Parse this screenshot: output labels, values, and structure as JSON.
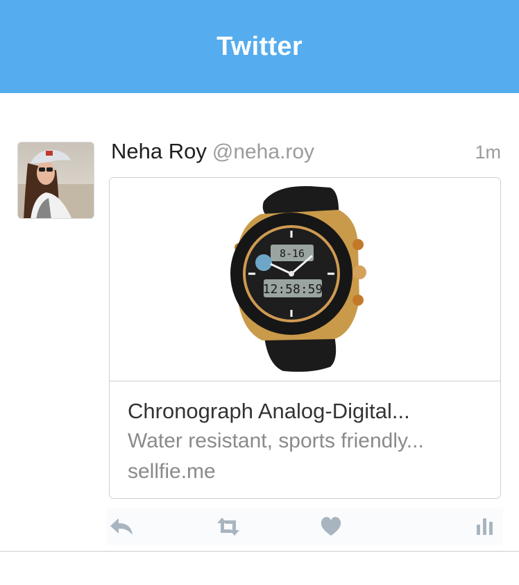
{
  "header": {
    "title": "Twitter"
  },
  "tweet": {
    "author_name": "Neha Roy",
    "author_handle": "@neha.roy",
    "timestamp": "1m",
    "card": {
      "title": "Chronograph Analog-Digital...",
      "description": "Water resistant, sports friendly...",
      "domain": "sellfie.me",
      "image": "chronograph-watch-image"
    },
    "actions": [
      "reply-icon",
      "retweet-icon",
      "like-icon",
      "stats-icon"
    ]
  },
  "colors": {
    "brand": "#55acee",
    "action_icon": "#a8b5c0",
    "muted_text": "#8a8a8a"
  }
}
